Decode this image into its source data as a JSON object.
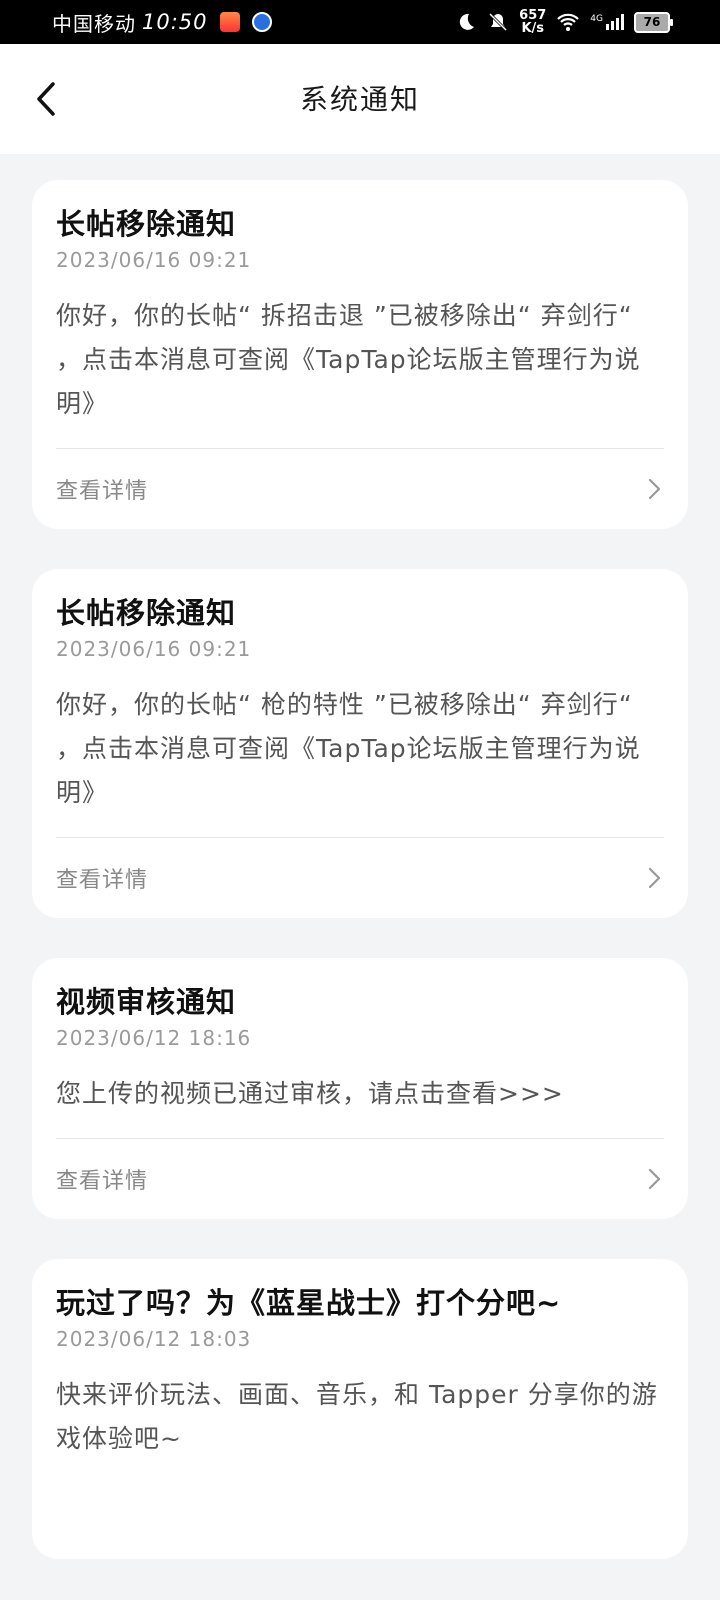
{
  "status_bar": {
    "carrier": "中国移动",
    "time": "10:50",
    "speed_value": "657",
    "speed_unit": "K/s",
    "network": "4G",
    "battery": "76"
  },
  "header": {
    "title": "系统通知"
  },
  "notifications": [
    {
      "title": "长帖移除通知",
      "time": "2023/06/16 09:21",
      "body": "你好，你的长帖“ 拆招击退 ”已被移除出“ 弃剑行“ ，点击本消息可查阅《TapTap论坛版主管理行为说明》",
      "detail_label": "查看详情"
    },
    {
      "title": "长帖移除通知",
      "time": "2023/06/16 09:21",
      "body": "你好，你的长帖“ 枪的特性 ”已被移除出“ 弃剑行“ ，点击本消息可查阅《TapTap论坛版主管理行为说明》",
      "detail_label": "查看详情"
    },
    {
      "title": "视频审核通知",
      "time": "2023/06/12 18:16",
      "body": "您上传的视频已通过审核，请点击查看>>>",
      "detail_label": "查看详情"
    },
    {
      "title": "玩过了吗？为《蓝星战士》打个分吧~",
      "time": "2023/06/12 18:03",
      "body": "快来评价玩法、画面、音乐，和 Tapper 分享你的游戏体验吧~"
    }
  ]
}
